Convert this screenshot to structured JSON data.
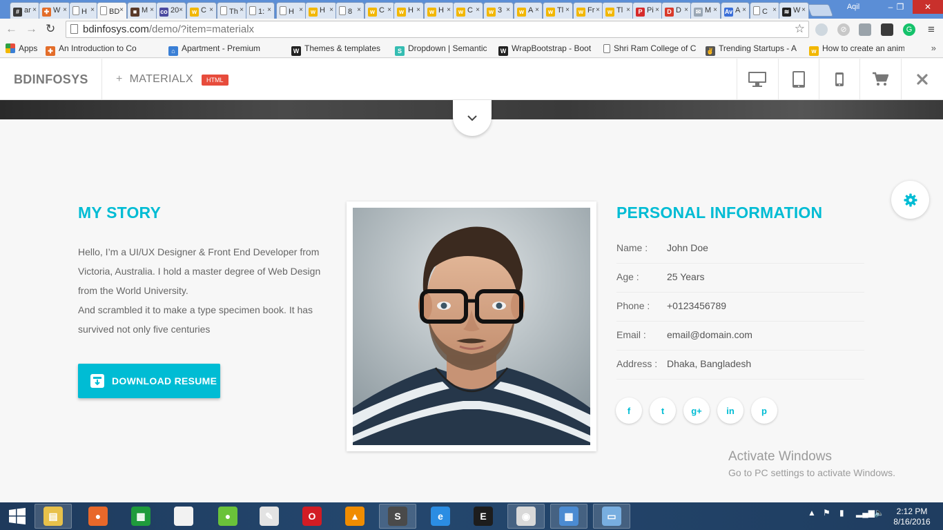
{
  "browser": {
    "tabs": [
      {
        "label": "ar",
        "fav": "#",
        "color": "#3a3a3a"
      },
      {
        "label": "W",
        "fav": "✚",
        "color": "#e36d2a"
      },
      {
        "label": "H",
        "fav": "",
        "color": ""
      },
      {
        "label": "BD",
        "fav": "",
        "color": "",
        "active": true
      },
      {
        "label": "M",
        "fav": "■",
        "color": "#5a3a2a"
      },
      {
        "label": "20",
        "fav": "co",
        "color": "#4a4aa0"
      },
      {
        "label": "C",
        "fav": "w",
        "color": "#f2b700"
      },
      {
        "label": "Th",
        "fav": "",
        "color": ""
      },
      {
        "label": "1:",
        "fav": "",
        "color": ""
      },
      {
        "label": "H",
        "fav": "",
        "color": ""
      },
      {
        "label": "H",
        "fav": "w",
        "color": "#f2b700"
      },
      {
        "label": "8",
        "fav": "",
        "color": ""
      },
      {
        "label": "C",
        "fav": "w",
        "color": "#f2b700"
      },
      {
        "label": "H",
        "fav": "w",
        "color": "#f2b700"
      },
      {
        "label": "H",
        "fav": "w",
        "color": "#f2b700"
      },
      {
        "label": "C",
        "fav": "w",
        "color": "#f2b700"
      },
      {
        "label": "3",
        "fav": "w",
        "color": "#f2b700"
      },
      {
        "label": "A",
        "fav": "w",
        "color": "#f2b700"
      },
      {
        "label": "Tl",
        "fav": "w",
        "color": "#f2b700"
      },
      {
        "label": "Fr",
        "fav": "w",
        "color": "#f2b700"
      },
      {
        "label": "Tl",
        "fav": "w",
        "color": "#f2b700"
      },
      {
        "label": "Pi",
        "fav": "P",
        "color": "#d62b2b"
      },
      {
        "label": "D",
        "fav": "D",
        "color": "#d93a2b"
      },
      {
        "label": "M",
        "fav": "✉",
        "color": "#9aa7b5"
      },
      {
        "label": "A",
        "fav": "Av",
        "color": "#3b6fd8"
      },
      {
        "label": "C",
        "fav": "",
        "color": ""
      },
      {
        "label": "W",
        "fav": "≋",
        "color": "#222222"
      }
    ],
    "profile_name": "Aqil",
    "url_host": "bdinfosys.com",
    "url_rest": "/demo/?item=materialx"
  },
  "bookmarks": [
    {
      "label": "Apps",
      "icon": "apps",
      "color": ""
    },
    {
      "label": "An Introduction to Co",
      "icon": "✚",
      "color": "#e36d2a"
    },
    {
      "label": "Apartment - Premium",
      "icon": "house",
      "color": "#3a7fd5"
    },
    {
      "label": "Themes & templates",
      "icon": "W",
      "color": "#222222"
    },
    {
      "label": "Dropdown | Semantic",
      "icon": "S",
      "color": "#35bdb2"
    },
    {
      "label": "WrapBootstrap - Boot",
      "icon": "W",
      "color": "#222222"
    },
    {
      "label": "Shri Ram College of C",
      "icon": "page",
      "color": ""
    },
    {
      "label": "Trending Startups - A",
      "icon": "✌",
      "color": "#555555"
    },
    {
      "label": "How to create an anim",
      "icon": "w",
      "color": "#f2b700"
    }
  ],
  "site_header": {
    "brand": "BDINFOSYS",
    "plus": "+",
    "demo_name": "MATERIALX",
    "badge": "HTML"
  },
  "story": {
    "title": "MY STORY",
    "paragraph_1": "Hello, I’m a UI/UX Designer & Front End Developer from Victoria, Australia. I hold a master degree of Web Design from the World University.",
    "paragraph_2": "And scrambled it to make a type specimen book. It has survived not only five centuries",
    "button_label": "DOWNLOAD RESUME"
  },
  "personal": {
    "title": "PERSONAL INFORMATION",
    "rows": [
      {
        "label": "Name :",
        "value": "John Doe"
      },
      {
        "label": "Age :",
        "value": "25 Years"
      },
      {
        "label": "Phone :",
        "value": "+0123456789"
      },
      {
        "label": "Email :",
        "value": "email@domain.com"
      },
      {
        "label": "Address :",
        "value": "Dhaka, Bangladesh"
      }
    ],
    "social": [
      {
        "name": "facebook",
        "glyph": "f"
      },
      {
        "name": "twitter",
        "glyph": "t"
      },
      {
        "name": "google-plus",
        "glyph": "g+"
      },
      {
        "name": "linkedin",
        "glyph": "in"
      },
      {
        "name": "pinterest",
        "glyph": "p"
      }
    ]
  },
  "watermark": {
    "line1": "Activate Windows",
    "line2": "Go to PC settings to activate Windows."
  },
  "taskbar": {
    "time": "2:12 PM",
    "date": "8/16/2016",
    "apps": [
      {
        "name": "file-explorer",
        "glyph": "▤",
        "color": "#e8c14a",
        "open": true
      },
      {
        "name": "firefox",
        "glyph": "●",
        "color": "#e8682a",
        "open": false
      },
      {
        "name": "store",
        "glyph": "▦",
        "color": "#1f9b3c",
        "open": false
      },
      {
        "name": "notepad",
        "glyph": "",
        "color": "#f2f2f2",
        "open": false
      },
      {
        "name": "frog-app",
        "glyph": "●",
        "color": "#6ac23a",
        "open": false
      },
      {
        "name": "paint-tool",
        "glyph": "✎",
        "color": "#e3e3e3",
        "open": false
      },
      {
        "name": "opera",
        "glyph": "O",
        "color": "#d21c24",
        "open": false
      },
      {
        "name": "vlc",
        "glyph": "▲",
        "color": "#f08c00",
        "open": false
      },
      {
        "name": "sublime-text",
        "glyph": "S",
        "color": "#4a4a4a",
        "open": true
      },
      {
        "name": "internet-explorer",
        "glyph": "e",
        "color": "#2b8de3",
        "open": false
      },
      {
        "name": "terminal-app",
        "glyph": "E",
        "color": "#1d1d1d",
        "open": false
      },
      {
        "name": "chrome",
        "glyph": "◉",
        "color": "#d9d9d9",
        "open": true
      },
      {
        "name": "control-panel",
        "glyph": "▦",
        "color": "#4b8bd2",
        "open": true
      },
      {
        "name": "photo-viewer",
        "glyph": "▭",
        "color": "#78aee0",
        "open": true
      }
    ]
  },
  "colors": {
    "accent": "#00bcd4",
    "badge": "#e74c3c",
    "tab_strip": "#5b8ed6"
  }
}
